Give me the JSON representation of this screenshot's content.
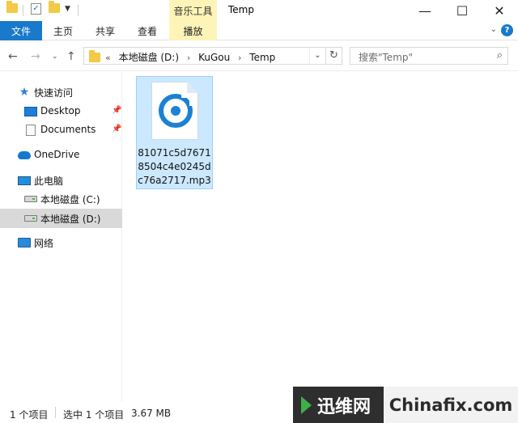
{
  "titlebar": {
    "context_tab_label": "音乐工具",
    "window_title": "Temp",
    "minimize_glyph": "—",
    "maximize_glyph": "☐",
    "close_glyph": "✕"
  },
  "ribbon": {
    "tabs": [
      "文件",
      "主页",
      "共享",
      "查看",
      "播放"
    ],
    "help_glyph": "?"
  },
  "address": {
    "overflow": "«",
    "crumbs": [
      "本地磁盘 (D:)",
      "KuGou",
      "Temp"
    ],
    "search_placeholder": "搜索\"Temp\""
  },
  "sidebar": {
    "quick_access": "快速访问",
    "desktop": "Desktop",
    "documents": "Documents",
    "onedrive": "OneDrive",
    "this_pc": "此电脑",
    "drive_c": "本地磁盘 (C:)",
    "drive_d": "本地磁盘 (D:)",
    "network": "网络"
  },
  "files": [
    {
      "name": "81071c5d76718504c4e0245dc76a2717.mp3",
      "icon": "music-file-icon",
      "selected": true
    }
  ],
  "status": {
    "item_count": "1 个项目",
    "selected": "选中 1 个项目",
    "size": "3.67 MB"
  },
  "watermark": {
    "cn": "迅维网",
    "en": "Chinafix.com"
  },
  "colors": {
    "accent": "#1979ca",
    "selection": "#cce8ff",
    "context_tab": "#fff4b8"
  }
}
